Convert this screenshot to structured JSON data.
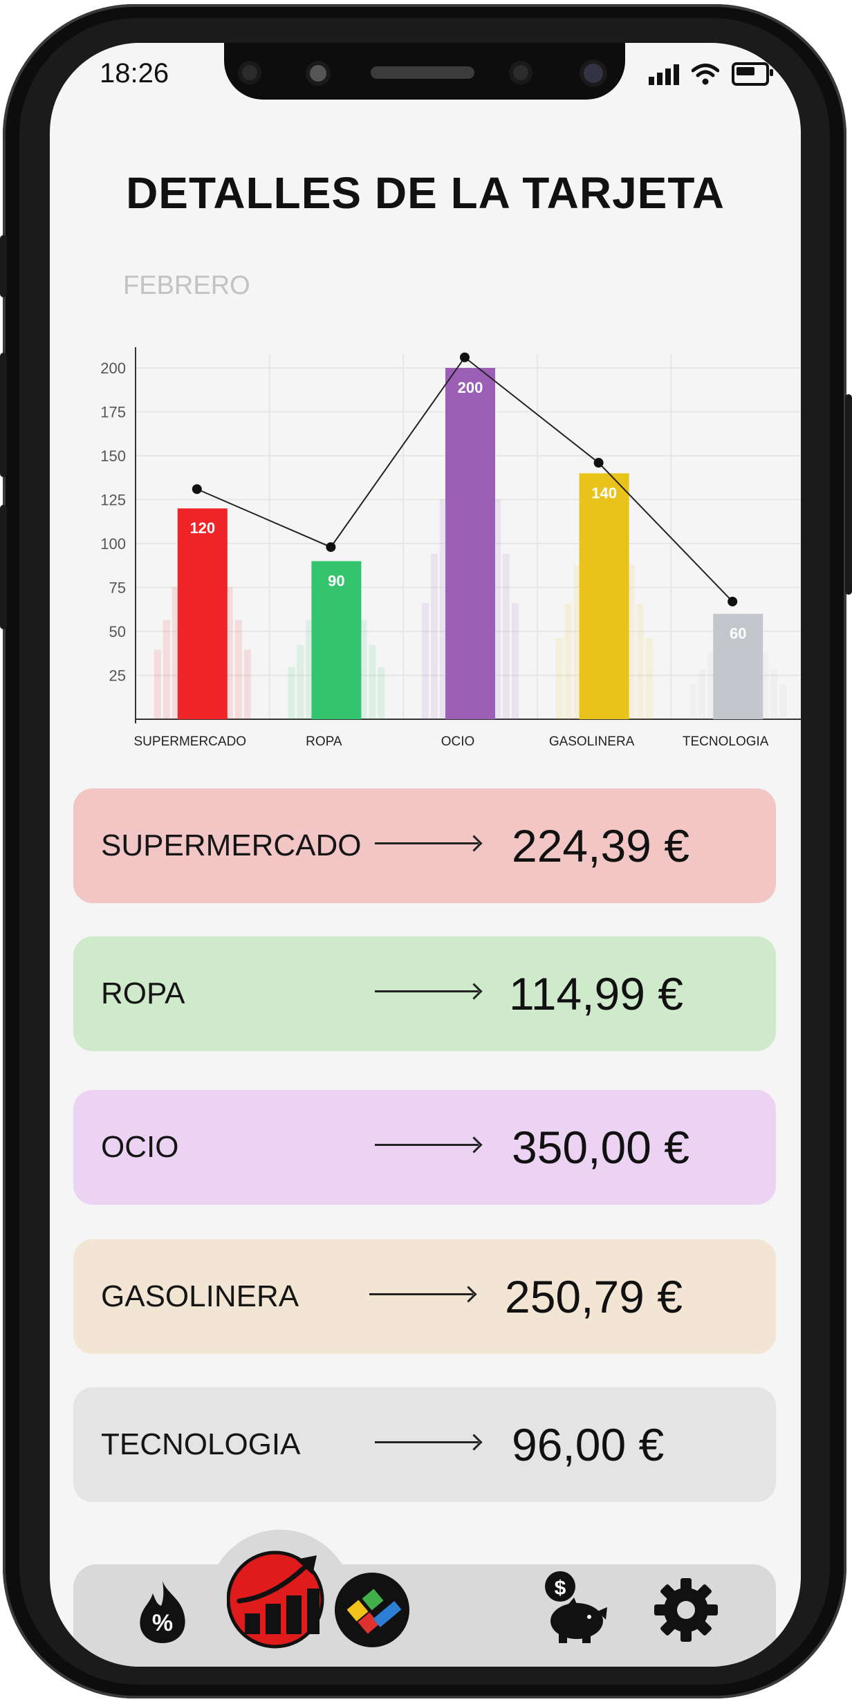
{
  "status_bar": {
    "time": "18:26"
  },
  "header": {
    "title": "DETALLES DE LA TARJETA",
    "month": "FEBRERO"
  },
  "chart_data": {
    "type": "bar",
    "categories": [
      "SUPERMERCADO",
      "ROPA",
      "OCIO",
      "GASOLINERA",
      "TECNOLOGIA"
    ],
    "values": [
      120,
      90,
      200,
      140,
      60
    ],
    "line_values": [
      131,
      98,
      206,
      146,
      67
    ],
    "colors": [
      "#ee2426",
      "#34c46e",
      "#9b5fb6",
      "#e9c21c",
      "#c3c7cb"
    ],
    "yticks": [
      25,
      50,
      75,
      100,
      125,
      150,
      175,
      200
    ],
    "ylim": [
      0,
      200
    ]
  },
  "categories": [
    {
      "label": "SUPERMERCADO",
      "amount": "224,39 €",
      "bg": "#f3c6c6"
    },
    {
      "label": "ROPA",
      "amount": "114,99 €",
      "bg": "#cfe9cb"
    },
    {
      "label": "OCIO",
      "amount": "350,00 €",
      "bg": "#ecd3f4"
    },
    {
      "label": "GASOLINERA",
      "amount": "250,79 €",
      "bg": "#f3e5d3"
    },
    {
      "label": "TECNOLOGIA",
      "amount": "96,00 €",
      "bg": "#e4e4e4"
    }
  ],
  "nav": {
    "items": [
      {
        "icon": "discount-flame-icon"
      },
      {
        "icon": "growth-chart-icon",
        "active": true
      },
      {
        "icon": "colorful-card-logo-icon"
      },
      {
        "icon": "savings-piggy-icon"
      },
      {
        "icon": "settings-gear-icon"
      }
    ]
  }
}
